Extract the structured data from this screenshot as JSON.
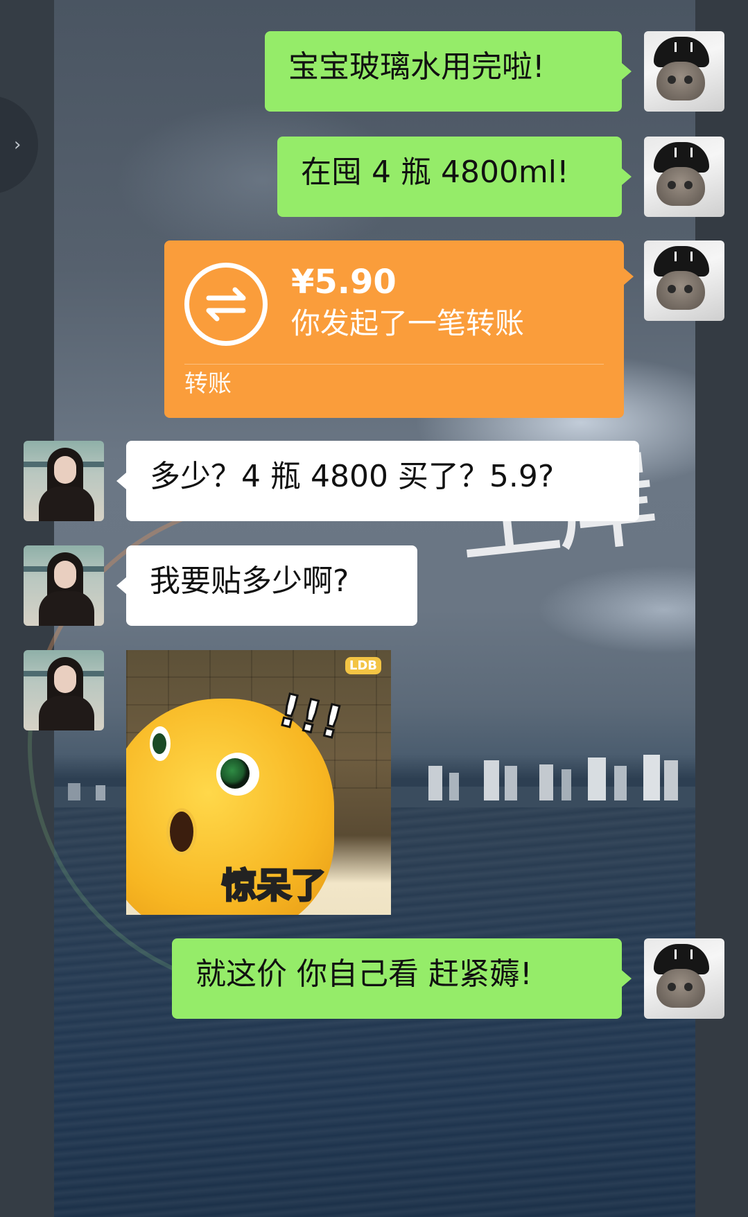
{
  "messages": [
    {
      "side": "right",
      "type": "text",
      "text": "宝宝玻璃水用完啦!"
    },
    {
      "side": "right",
      "type": "text",
      "text": "在囤 4 瓶 4800ml!"
    },
    {
      "side": "right",
      "type": "transfer",
      "amount": "¥5.90",
      "description": "你发起了一笔转账",
      "footer": "转账"
    },
    {
      "side": "left",
      "type": "text",
      "text": "多少？4 瓶 4800 买了？5.9?"
    },
    {
      "side": "left",
      "type": "text",
      "text": "我要贴多少啊?"
    },
    {
      "side": "left",
      "type": "sticker",
      "caption": "惊呆了",
      "marks": "!!!",
      "brand": "LDB"
    },
    {
      "side": "right",
      "type": "text",
      "text": "就这价 你自己看 赶紧薅!"
    }
  ],
  "background": {
    "overlay_text": "上岸"
  },
  "colors": {
    "sent_bubble": "#95ec69",
    "received_bubble": "#ffffff",
    "transfer_card": "#fa9d3b"
  },
  "icons": {
    "collapse": "chevron-right-icon",
    "transfer": "transfer-arrows-icon"
  }
}
